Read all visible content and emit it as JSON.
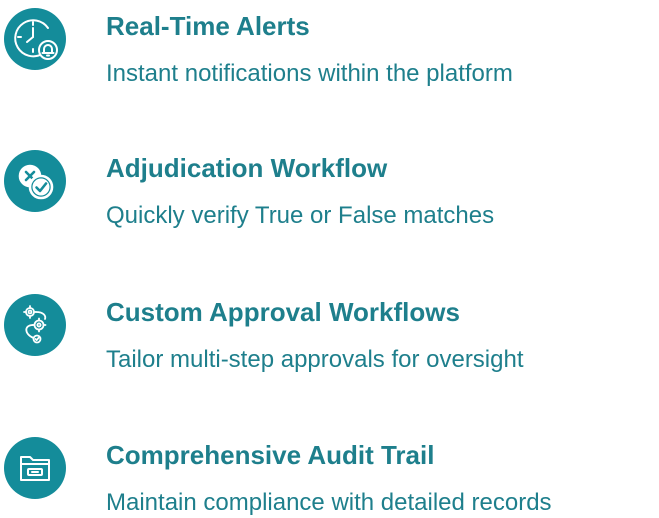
{
  "features": [
    {
      "icon": "alarm-clock-bell-icon",
      "title": "Real-Time Alerts",
      "description": "Instant notifications within the platform"
    },
    {
      "icon": "x-check-icon",
      "title": "Adjudication Workflow",
      "description": "Quickly verify True or False matches"
    },
    {
      "icon": "gears-workflow-icon",
      "title": "Custom Approval Workflows",
      "description": "Tailor multi-step approvals for oversight"
    },
    {
      "icon": "folder-archive-icon",
      "title": "Comprehensive Audit Trail",
      "description": "Maintain compliance with detailed records"
    }
  ],
  "colors": {
    "accent": "#148c9a",
    "text": "#1e7f8c",
    "background": "#ffffff"
  }
}
